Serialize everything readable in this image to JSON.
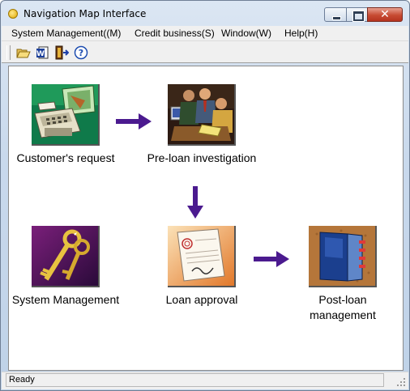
{
  "window": {
    "title": "Navigation Map Interface"
  },
  "menu": {
    "items": [
      {
        "label": "System Management((M)"
      },
      {
        "label": "Credit business(S)"
      },
      {
        "label": "Window(W)"
      },
      {
        "label": "Help(H)"
      }
    ]
  },
  "toolbar": {
    "buttons": [
      {
        "icon": "open-folder-icon"
      },
      {
        "icon": "word-document-icon"
      },
      {
        "icon": "exit-door-icon"
      },
      {
        "icon": "help-icon"
      }
    ]
  },
  "flow": {
    "nodes": [
      {
        "id": "customers-request",
        "label": "Customer's request"
      },
      {
        "id": "pre-loan-investigation",
        "label": "Pre-loan investigation"
      },
      {
        "id": "system-management",
        "label": "System Management"
      },
      {
        "id": "loan-approval",
        "label": "Loan approval"
      },
      {
        "id": "post-loan-management",
        "label": "Post-loan management"
      }
    ],
    "arrow_color": "#4b1a8f"
  },
  "status": {
    "text": "Ready"
  },
  "colors": {
    "title_gradient_top": "#dbe6f3",
    "close_button": "#c74b33",
    "client_background": "#ffffff",
    "arrow": "#4b1a8f"
  }
}
